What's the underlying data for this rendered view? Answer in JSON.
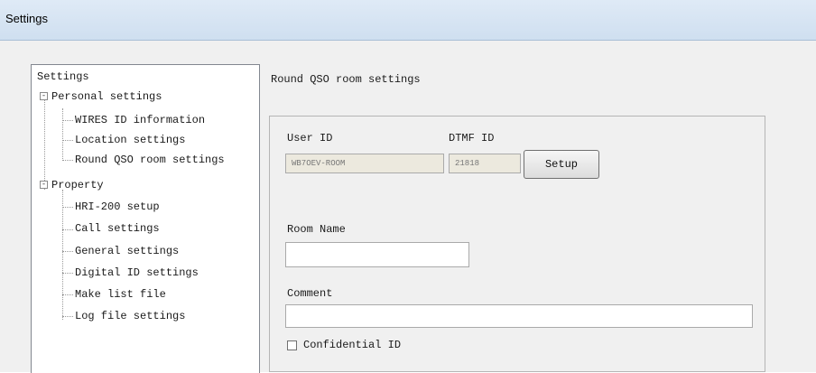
{
  "window": {
    "title": "Settings"
  },
  "tree": {
    "root": "Settings",
    "groups": [
      {
        "label": "Personal settings",
        "expander": "-",
        "children": [
          "WIRES ID information",
          "Location settings",
          "Round QSO room settings"
        ]
      },
      {
        "label": "Property",
        "expander": "-",
        "children": [
          "HRI-200 setup",
          "Call settings",
          "General settings",
          "Digital ID settings",
          "Make list file",
          "Log file settings"
        ]
      }
    ]
  },
  "panel": {
    "heading": "Round QSO room settings",
    "user_id_label": "User ID",
    "user_id_value": "WB7OEV-ROOM",
    "dtmf_id_label": "DTMF ID",
    "dtmf_id_value": "21818",
    "setup_label": "Setup",
    "room_name_label": "Room Name",
    "room_name_value": "",
    "comment_label": "Comment",
    "comment_value": "",
    "confidential_label": "Confidential ID",
    "confidential_checked": false
  }
}
